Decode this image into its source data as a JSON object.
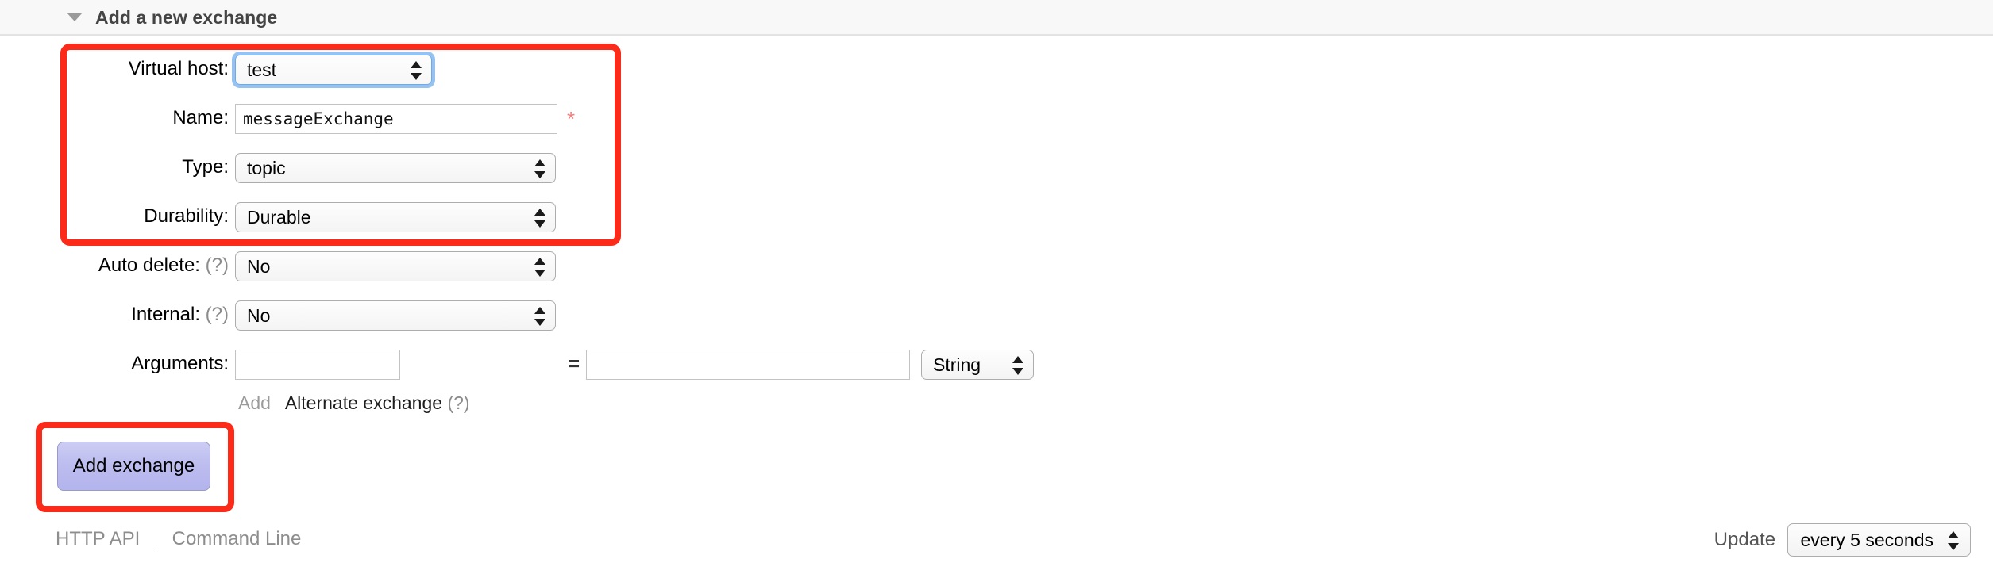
{
  "section": {
    "title": "Add a new exchange",
    "caret_icon": "triangle-down-icon",
    "expanded": true
  },
  "form": {
    "rows": [
      {
        "label": "Virtual host:",
        "hint": "",
        "control": "select",
        "value": "test",
        "focused": true,
        "highlighted": true
      },
      {
        "label": "Name:",
        "hint": "",
        "control": "text",
        "value": "messageExchange",
        "required_marker": "*",
        "highlighted": true
      },
      {
        "label": "Type:",
        "hint": "",
        "control": "select",
        "value": "topic",
        "focused": false,
        "highlighted": true
      },
      {
        "label": "Durability:",
        "hint": "",
        "control": "select",
        "value": "Durable",
        "focused": false,
        "highlighted": true
      },
      {
        "label": "Auto delete:",
        "hint": "(?)",
        "control": "select",
        "value": "No",
        "focused": false,
        "highlighted": false
      },
      {
        "label": "Internal:",
        "hint": "(?)",
        "control": "select",
        "value": "No",
        "focused": false,
        "highlighted": false
      }
    ],
    "arguments": {
      "label": "Arguments:",
      "key_value": "",
      "key_placeholder": "",
      "equals": "=",
      "value_value": "",
      "value_placeholder": "",
      "type_value": "String"
    },
    "arg_actions": {
      "add_label": "Add",
      "alternate_label": "Alternate exchange",
      "alternate_hint": "(?)"
    },
    "submit_label": "Add exchange"
  },
  "footer": {
    "http_api_label": "HTTP API",
    "command_line_label": "Command Line",
    "update_label": "Update",
    "update_value": "every 5 seconds"
  },
  "annotations": {
    "fields_box_color": "#fb2a19",
    "button_box_color": "#fb2a19"
  }
}
